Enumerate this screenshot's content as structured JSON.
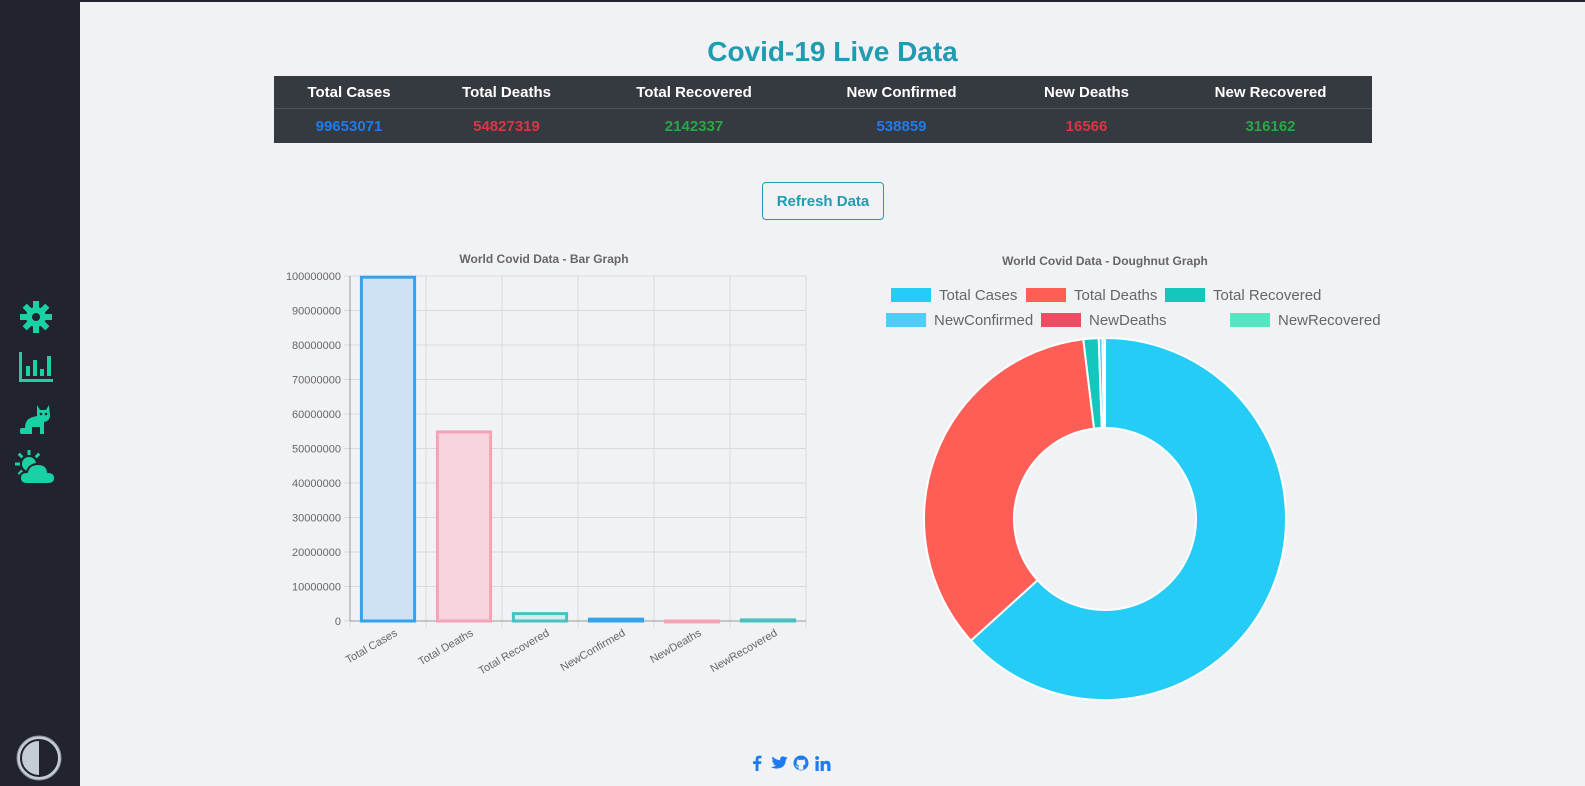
{
  "header": {
    "title": "Covid-19 Live Data"
  },
  "stats": {
    "headers": [
      "Total Cases",
      "Total Deaths",
      "Total Recovered",
      "New Confirmed",
      "New Deaths",
      "New Recovered"
    ],
    "values": [
      "99653071",
      "54827319",
      "2142337",
      "538859",
      "16566",
      "316162"
    ],
    "value_colors": [
      "#1f7bf0",
      "#dc3545",
      "#28a745",
      "#1f7bf0",
      "#dc3545",
      "#28a745"
    ]
  },
  "refresh": {
    "label": "Refresh Data"
  },
  "sidebar": {
    "icons": [
      "gear-icon",
      "bar-chart-icon",
      "cat-icon",
      "weather-icon"
    ]
  },
  "chart_data": [
    {
      "type": "bar",
      "title": "World Covid Data - Bar Graph",
      "categories": [
        "Total Cases",
        "Total Deaths",
        "Total Recovered",
        "NewConfirmed",
        "NewDeaths",
        "NewRecovered"
      ],
      "values": [
        99653071,
        54827319,
        2142337,
        538859,
        16566,
        316162
      ],
      "ylim": [
        0,
        100000000
      ],
      "yticks": [
        "0",
        "10000000",
        "20000000",
        "30000000",
        "40000000",
        "50000000",
        "60000000",
        "70000000",
        "80000000",
        "90000000",
        "100000000"
      ],
      "fill_colors": [
        "#cfe2f5",
        "#f6d5de",
        "#d3eeec",
        "#cfe2f5",
        "#f6d5de",
        "#d3eeec"
      ],
      "stroke_colors": [
        "#36a2eb",
        "#f5a3b5",
        "#4bc0c0",
        "#36a2eb",
        "#f5a3b5",
        "#4bc0c0"
      ],
      "grid": true
    },
    {
      "type": "pie",
      "title": "World Covid Data - Doughnut Graph",
      "categories": [
        "Total Cases",
        "Total Deaths",
        "Total Recovered",
        "NewConfirmed",
        "NewDeaths",
        "NewRecovered"
      ],
      "values": [
        99653071,
        54827319,
        2142337,
        538859,
        16566,
        316162
      ],
      "colors": [
        "#24ccf6",
        "#ff5e57",
        "#14c7bd",
        "#4fcdf8",
        "#eb4d62",
        "#55e6c1"
      ],
      "legend": "top"
    }
  ],
  "footer": {
    "icons": [
      "facebook-icon",
      "twitter-icon",
      "github-icon",
      "linkedin-icon"
    ]
  }
}
